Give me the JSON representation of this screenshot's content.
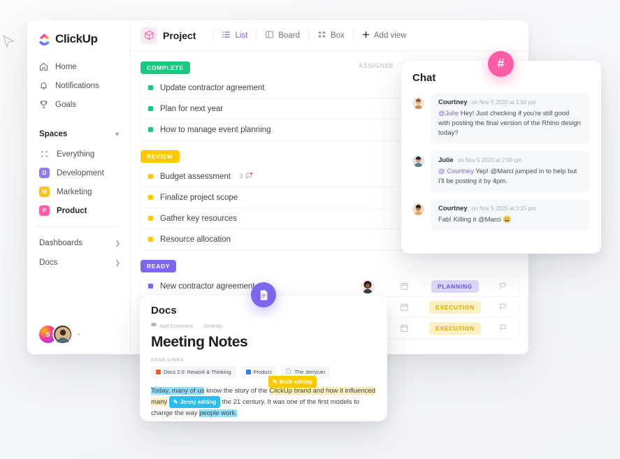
{
  "brand": {
    "name": "ClickUp"
  },
  "sidebar": {
    "nav": [
      {
        "label": "Home",
        "icon": "home-icon"
      },
      {
        "label": "Notifications",
        "icon": "bell-icon"
      },
      {
        "label": "Goals",
        "icon": "trophy-icon"
      }
    ],
    "spaces_title": "Spaces",
    "spaces": [
      {
        "label": "Everything",
        "badge": "",
        "color": "",
        "active": false
      },
      {
        "label": "Development",
        "badge": "D",
        "color": "#8f7df0",
        "active": false
      },
      {
        "label": "Marketing",
        "badge": "M",
        "color": "#fdc22a",
        "active": false
      },
      {
        "label": "Product",
        "badge": "P",
        "color": "#ff5ca8",
        "active": true
      }
    ],
    "tree": [
      {
        "label": "Dashboards"
      },
      {
        "label": "Docs"
      }
    ],
    "user_tray": {
      "initial": "S",
      "chevron": "▾"
    }
  },
  "toolbar": {
    "project_label": "Project",
    "views": [
      {
        "label": "List",
        "icon": "list-icon",
        "active": true
      },
      {
        "label": "Board",
        "icon": "board-icon",
        "active": false
      },
      {
        "label": "Box",
        "icon": "box-icon",
        "active": false
      }
    ],
    "add_view_label": "Add view"
  },
  "list": {
    "assignee_header": "ASSIGNEE",
    "groups": [
      {
        "status": "COMPLETE",
        "status_color": "#18c97f",
        "dot_color": "#18c97f",
        "tasks": [
          {
            "name": "Update contractor agreement",
            "comments": "",
            "avatar_bg": "#f9d3e6",
            "avatar_fg": "#3c4152"
          },
          {
            "name": "Plan for next year",
            "comments": "",
            "avatar_bg": "#d9f0fb",
            "avatar_fg": "#e8a878"
          },
          {
            "name": "How to manage event planning",
            "comments": "",
            "avatar_bg": "#e7f6e3",
            "avatar_fg": "#8c6a52"
          }
        ]
      },
      {
        "status": "REVIEW",
        "status_color": "#ffc800",
        "dot_color": "#ffc800",
        "tasks": [
          {
            "name": "Budget assessment",
            "comments": "3",
            "avatar_bg": "#f6efe4",
            "avatar_fg": "#50392a"
          },
          {
            "name": "Finalize project scope",
            "comments": "",
            "avatar_bg": "#eceef1",
            "avatar_fg": "#3d2f27"
          },
          {
            "name": "Gather key resources",
            "comments": "",
            "avatar_bg": "#f7e6ef",
            "avatar_fg": "#2e2420"
          },
          {
            "name": "Resource allocation",
            "comments": "",
            "avatar_bg": "#f7e6ef",
            "avatar_fg": "#2e2420"
          }
        ]
      },
      {
        "status": "READY",
        "status_color": "#7b68ee",
        "dot_color": "#7b68ee",
        "tasks": [
          {
            "name": "New contractor agreement",
            "comments": "",
            "avatar_bg": "#f7e6ef",
            "avatar_fg": "#2e2420",
            "tag": "PLANNING",
            "tag_bg": "#ded8fb",
            "tag_fg": "#6c57e8"
          },
          {
            "name": "",
            "comments": "",
            "avatar_bg": "",
            "avatar_fg": "",
            "tag": "EXECUTION",
            "tag_bg": "#fdf0c1",
            "tag_fg": "#e0a800"
          },
          {
            "name": "",
            "comments": "",
            "avatar_bg": "",
            "avatar_fg": "",
            "tag": "EXECUTION",
            "tag_bg": "#fdf0c1",
            "tag_fg": "#e0a800"
          }
        ]
      }
    ]
  },
  "chat": {
    "badge": "#",
    "title": "Chat",
    "messages": [
      {
        "author": "Courtney",
        "time": "on Nov 5 2020 at 1:50 pm",
        "mention": "@Julie",
        "text": " Hey! Just checking if you're still good with posting the final version of the Rhino design today?",
        "avatar_bg": "#f3e4d8"
      },
      {
        "author": "Julie",
        "time": "on Nov 5 2020 at 2:50 pm",
        "mention": "@ Courtney",
        "text": " Yep! @Marci jumped in to help but I'll be posting it by 4pm.",
        "avatar_bg": "#dbe7ef"
      },
      {
        "author": "Courtney",
        "time": "on Nov 5 2020 at 3:15 pm",
        "mention": "",
        "text": "Fab! Killing it @Marci 😀",
        "avatar_bg": "#f2e0cb"
      }
    ]
  },
  "docs": {
    "badge_icon": "document-icon",
    "title": "Docs",
    "actions": [
      {
        "label": "Add Comment",
        "icon": "comment-icon"
      },
      {
        "label": "Settings",
        "icon": ""
      }
    ],
    "heading": "Meeting Notes",
    "links_label": "PAGE LINKS",
    "links": [
      {
        "label": "Docs 2.0: Rework & Thinking",
        "color": "#ff5722",
        "icon": "square-icon"
      },
      {
        "label": "Product",
        "color": "#2f80ed",
        "icon": "folder-icon"
      },
      {
        "label": "The Jerrycan",
        "color": "#b0b5bf",
        "icon": "page-icon"
      }
    ],
    "mark_editing_label": "Mark editing",
    "jenny_editing_label": "Jenny editing",
    "body_parts": {
      "p1": "Today, many of us",
      "p2": " know the story of the ",
      "p3": "ClickUp brand and how it influenced many",
      "p4": " the 21 century. It was one of the first models  to change the way ",
      "p5": "people work."
    }
  }
}
